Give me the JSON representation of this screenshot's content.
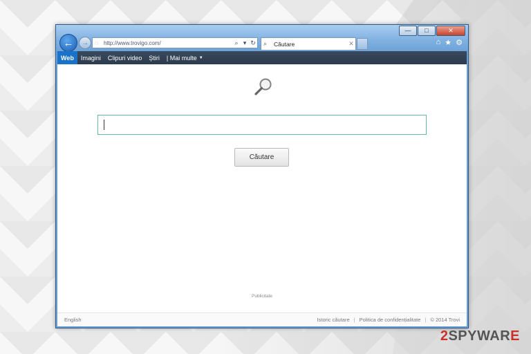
{
  "browser": {
    "url": "http://www.trovigo.com/",
    "tab_title": "Căutare",
    "window_controls": {
      "minimize": "—",
      "maximize": "□",
      "close": "✕"
    },
    "toolbar_icons": [
      "home-icon",
      "favorites-star-icon",
      "settings-gear-icon"
    ]
  },
  "menu": {
    "items": [
      {
        "label": "Web",
        "active": true
      },
      {
        "label": "Imagini"
      },
      {
        "label": "Clipuri video"
      },
      {
        "label": "Știri"
      },
      {
        "label": "| Mai multe"
      }
    ]
  },
  "search": {
    "input_value": "",
    "button_label": "Căutare"
  },
  "ad_label": "Publicitate",
  "footer": {
    "language": "English",
    "links": [
      {
        "label": "Istoric căutare"
      },
      {
        "label": "Politica de confidențialitate"
      },
      {
        "label": "© 2014 Trovi"
      }
    ]
  },
  "watermark": {
    "prefix": "2",
    "brand_dark": "SPYWAR",
    "brand_red": "E"
  },
  "colors": {
    "menu_active": "#1a73c8",
    "menu_bg": "#2c3b4d",
    "search_border": "#5fb7a6",
    "window_frame": "#6a9ed6"
  }
}
